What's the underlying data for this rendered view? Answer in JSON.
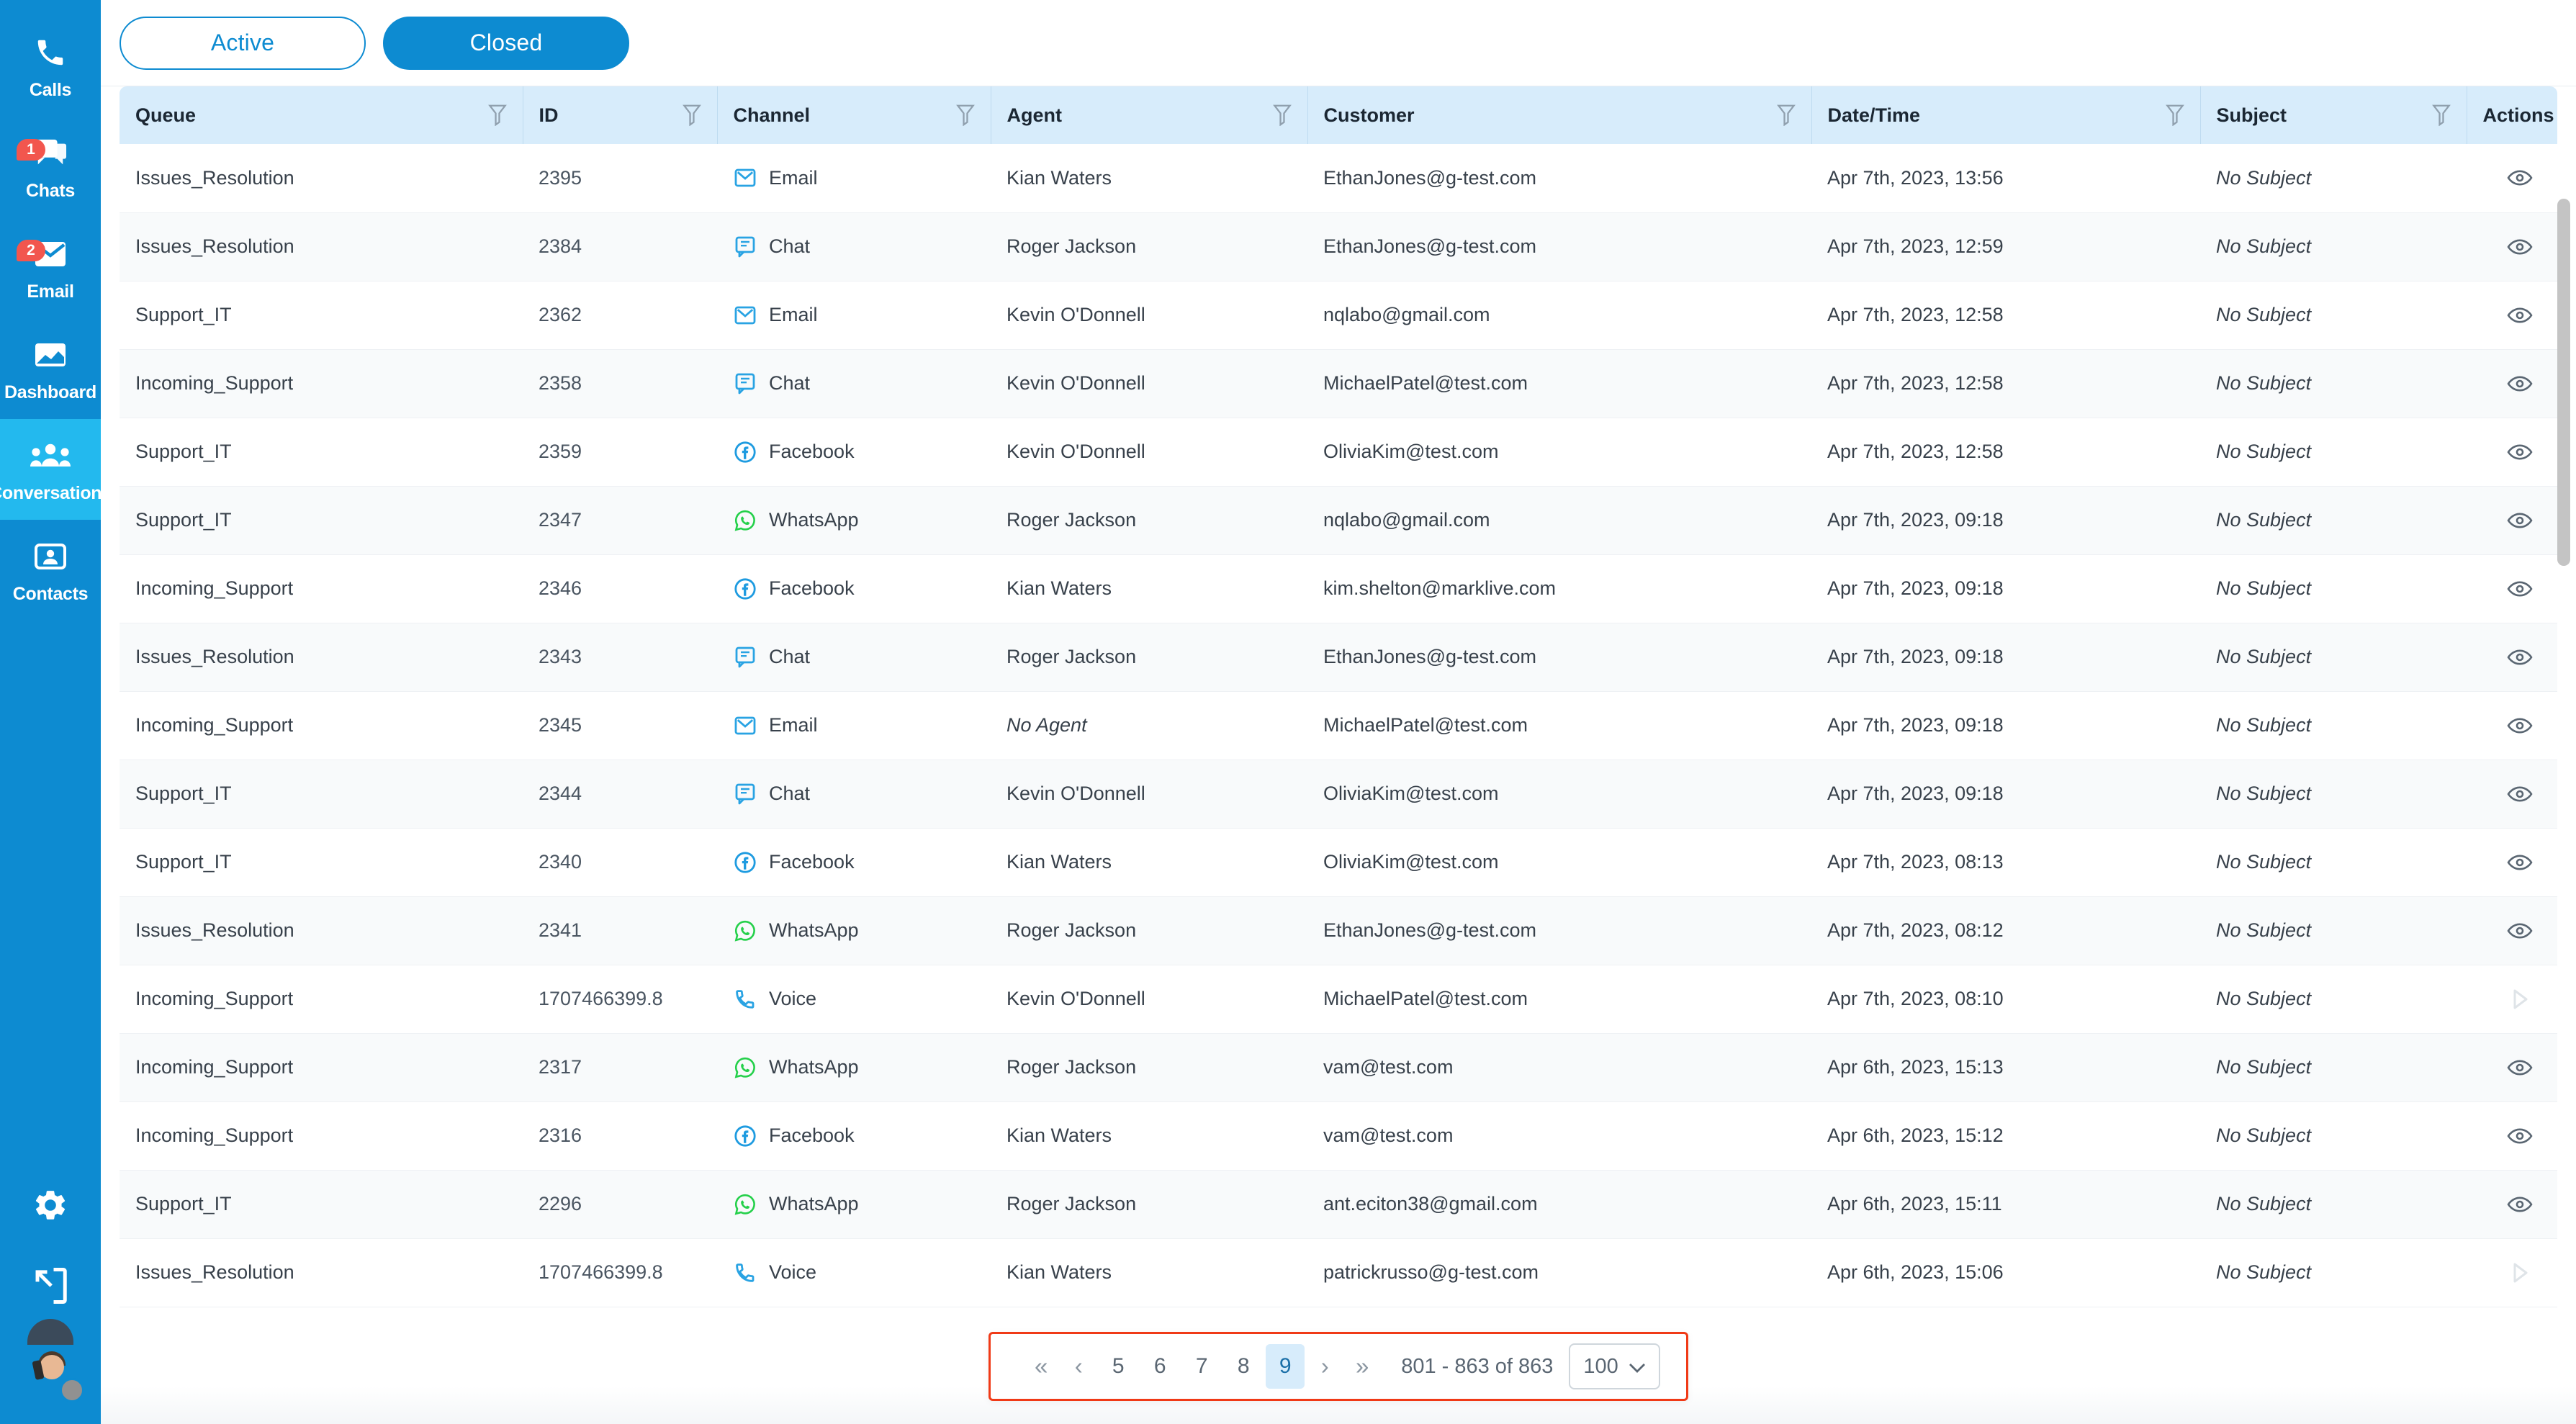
{
  "sidebar": {
    "items": [
      {
        "label": "Calls",
        "icon": "phone-icon",
        "badge": null,
        "active": false
      },
      {
        "label": "Chats",
        "icon": "chat-bubble-icon",
        "badge": "1",
        "active": false
      },
      {
        "label": "Email",
        "icon": "envelope-icon",
        "badge": "2",
        "active": false
      },
      {
        "label": "Dashboard",
        "icon": "dashboard-icon",
        "badge": null,
        "active": false
      },
      {
        "label": "Conversations",
        "icon": "people-group-icon",
        "badge": null,
        "active": true
      },
      {
        "label": "Contacts",
        "icon": "contact-card-icon",
        "badge": null,
        "active": false
      }
    ],
    "bottom": {
      "settings_icon": "gear-icon",
      "logout_icon": "logout-icon",
      "avatar_icon": "user-avatar",
      "status": "offline"
    },
    "colors": {
      "background": "#0d8bd1",
      "active_background": "#23b9ee",
      "badge": "#f2564e"
    }
  },
  "toolbar": {
    "tabs": [
      {
        "label": "Active",
        "selected": false
      },
      {
        "label": "Closed",
        "selected": true
      }
    ],
    "accent": "#0d8bd1"
  },
  "table": {
    "columns": [
      {
        "label": "Queue",
        "filter": true
      },
      {
        "label": "ID",
        "filter": true
      },
      {
        "label": "Channel",
        "filter": true
      },
      {
        "label": "Agent",
        "filter": true
      },
      {
        "label": "Customer",
        "filter": true
      },
      {
        "label": "Date/Time",
        "filter": true
      },
      {
        "label": "Subject",
        "filter": true
      },
      {
        "label": "Actions",
        "filter": false
      }
    ],
    "empty_subject_text": "No Subject",
    "empty_agent_text": "No Agent",
    "rows": [
      {
        "queue": "Issues_Resolution",
        "id": "2395",
        "channel": "Email",
        "agent": "Kian Waters",
        "customer": "EthanJones@g-test.com",
        "datetime": "Apr 7th, 2023, 13:56",
        "subject": "No Subject",
        "action": "view"
      },
      {
        "queue": "Issues_Resolution",
        "id": "2384",
        "channel": "Chat",
        "agent": "Roger Jackson",
        "customer": "EthanJones@g-test.com",
        "datetime": "Apr 7th, 2023, 12:59",
        "subject": "No Subject",
        "action": "view"
      },
      {
        "queue": "Support_IT",
        "id": "2362",
        "channel": "Email",
        "agent": "Kevin O'Donnell",
        "customer": "nqlabo@gmail.com",
        "datetime": "Apr 7th, 2023, 12:58",
        "subject": "No Subject",
        "action": "view"
      },
      {
        "queue": "Incoming_Support",
        "id": "2358",
        "channel": "Chat",
        "agent": "Kevin O'Donnell",
        "customer": "MichaelPatel@test.com",
        "datetime": "Apr 7th, 2023, 12:58",
        "subject": "No Subject",
        "action": "view"
      },
      {
        "queue": "Support_IT",
        "id": "2359",
        "channel": "Facebook",
        "agent": "Kevin O'Donnell",
        "customer": "OliviaKim@test.com",
        "datetime": "Apr 7th, 2023, 12:58",
        "subject": "No Subject",
        "action": "view"
      },
      {
        "queue": "Support_IT",
        "id": "2347",
        "channel": "WhatsApp",
        "agent": "Roger Jackson",
        "customer": "nqlabo@gmail.com",
        "datetime": "Apr 7th, 2023, 09:18",
        "subject": "No Subject",
        "action": "view"
      },
      {
        "queue": "Incoming_Support",
        "id": "2346",
        "channel": "Facebook",
        "agent": "Kian Waters",
        "customer": "kim.shelton@marklive.com",
        "datetime": "Apr 7th, 2023, 09:18",
        "subject": "No Subject",
        "action": "view"
      },
      {
        "queue": "Issues_Resolution",
        "id": "2343",
        "channel": "Chat",
        "agent": "Roger Jackson",
        "customer": "EthanJones@g-test.com",
        "datetime": "Apr 7th, 2023, 09:18",
        "subject": "No Subject",
        "action": "view"
      },
      {
        "queue": "Incoming_Support",
        "id": "2345",
        "channel": "Email",
        "agent": "No Agent",
        "customer": "MichaelPatel@test.com",
        "datetime": "Apr 7th, 2023, 09:18",
        "subject": "No Subject",
        "action": "view"
      },
      {
        "queue": "Support_IT",
        "id": "2344",
        "channel": "Chat",
        "agent": "Kevin O'Donnell",
        "customer": "OliviaKim@test.com",
        "datetime": "Apr 7th, 2023, 09:18",
        "subject": "No Subject",
        "action": "view"
      },
      {
        "queue": "Support_IT",
        "id": "2340",
        "channel": "Facebook",
        "agent": "Kian Waters",
        "customer": "OliviaKim@test.com",
        "datetime": "Apr 7th, 2023, 08:13",
        "subject": "No Subject",
        "action": "view"
      },
      {
        "queue": "Issues_Resolution",
        "id": "2341",
        "channel": "WhatsApp",
        "agent": "Roger Jackson",
        "customer": "EthanJones@g-test.com",
        "datetime": "Apr 7th, 2023, 08:12",
        "subject": "No Subject",
        "action": "view"
      },
      {
        "queue": "Incoming_Support",
        "id": "1707466399.8",
        "channel": "Voice",
        "agent": "Kevin O'Donnell",
        "customer": "MichaelPatel@test.com",
        "datetime": "Apr 7th, 2023, 08:10",
        "subject": "No Subject",
        "action": "play"
      },
      {
        "queue": "Incoming_Support",
        "id": "2317",
        "channel": "WhatsApp",
        "agent": "Roger Jackson",
        "customer": "vam@test.com",
        "datetime": "Apr 6th, 2023, 15:13",
        "subject": "No Subject",
        "action": "view"
      },
      {
        "queue": "Incoming_Support",
        "id": "2316",
        "channel": "Facebook",
        "agent": "Kian Waters",
        "customer": "vam@test.com",
        "datetime": "Apr 6th, 2023, 15:12",
        "subject": "No Subject",
        "action": "view"
      },
      {
        "queue": "Support_IT",
        "id": "2296",
        "channel": "WhatsApp",
        "agent": "Roger Jackson",
        "customer": "ant.eciton38@gmail.com",
        "datetime": "Apr 6th, 2023, 15:11",
        "subject": "No Subject",
        "action": "view"
      },
      {
        "queue": "Issues_Resolution",
        "id": "1707466399.8",
        "channel": "Voice",
        "agent": "Kian Waters",
        "customer": "patrickrusso@g-test.com",
        "datetime": "Apr 6th, 2023, 15:06",
        "subject": "No Subject",
        "action": "play"
      }
    ]
  },
  "pagination": {
    "first_label": "«",
    "prev_label": "‹",
    "pages": [
      "5",
      "6",
      "7",
      "8",
      "9"
    ],
    "active_page": "9",
    "next_label": "›",
    "last_label": "»",
    "range_text": "801 - 863 of 863",
    "page_size": "100",
    "highlight_color": "#f03a17"
  }
}
